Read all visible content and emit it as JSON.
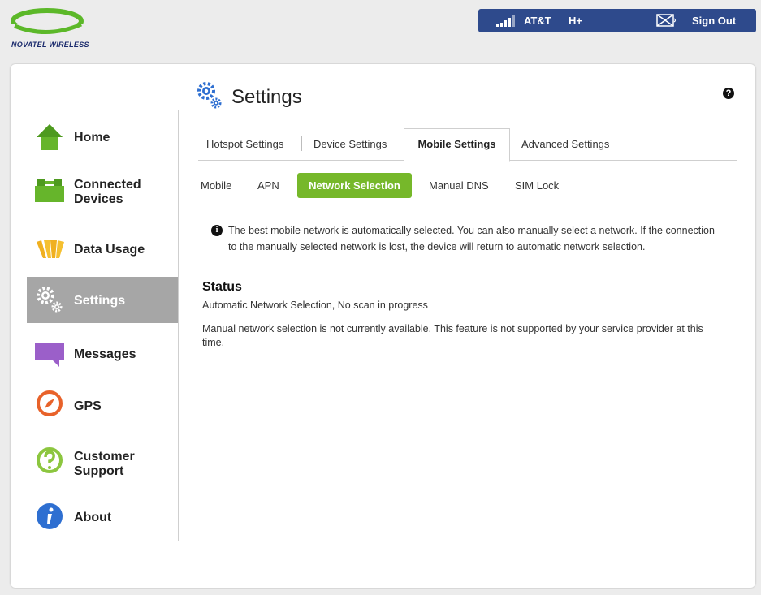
{
  "brand": {
    "name": "NOVATEL WIRELESS"
  },
  "status_bar": {
    "carrier": "AT&T",
    "network_type": "H+",
    "signout_label": "Sign Out",
    "signal_icon": "signal-bars-icon",
    "message_icon": "envelope-icon"
  },
  "sidebar": {
    "items": [
      {
        "label": "Home",
        "icon": "home-icon"
      },
      {
        "label": "Connected Devices",
        "icon": "connected-devices-icon"
      },
      {
        "label": "Data Usage",
        "icon": "data-usage-icon"
      },
      {
        "label": "Settings",
        "icon": "gear-icon",
        "active": true
      },
      {
        "label": "Messages",
        "icon": "message-bubble-icon"
      },
      {
        "label": "GPS",
        "icon": "compass-icon"
      },
      {
        "label": "Customer Support",
        "icon": "support-icon"
      },
      {
        "label": "About",
        "icon": "info-icon"
      }
    ]
  },
  "page": {
    "title": "Settings",
    "help_icon": "help-icon"
  },
  "tabs": {
    "hotspot": "Hotspot Settings",
    "device": "Device Settings",
    "mobile": "Mobile Settings",
    "advanced": "Advanced Settings",
    "active": "Mobile Settings"
  },
  "subtabs": {
    "mobile": "Mobile",
    "apn": "APN",
    "network_selection": "Network Selection",
    "manual_dns": "Manual DNS",
    "sim_lock": "SIM Lock",
    "active": "Network Selection"
  },
  "content": {
    "info": "The best mobile network is automatically selected. You can also manually select a network. If the connection to the manually selected network is lost, the device will return to automatic network selection.",
    "status_heading": "Status",
    "status_value": "Automatic Network Selection, No scan in progress",
    "manual_note": "Manual network selection is not currently available. This feature is not supported by your service provider at this time."
  },
  "colors": {
    "status_bar_bg": "#2e4a8c",
    "accent_green": "#76b82a",
    "active_nav_bg": "#a6a6a6",
    "panel_bg": "#ffffff",
    "page_bg": "#ececec"
  }
}
